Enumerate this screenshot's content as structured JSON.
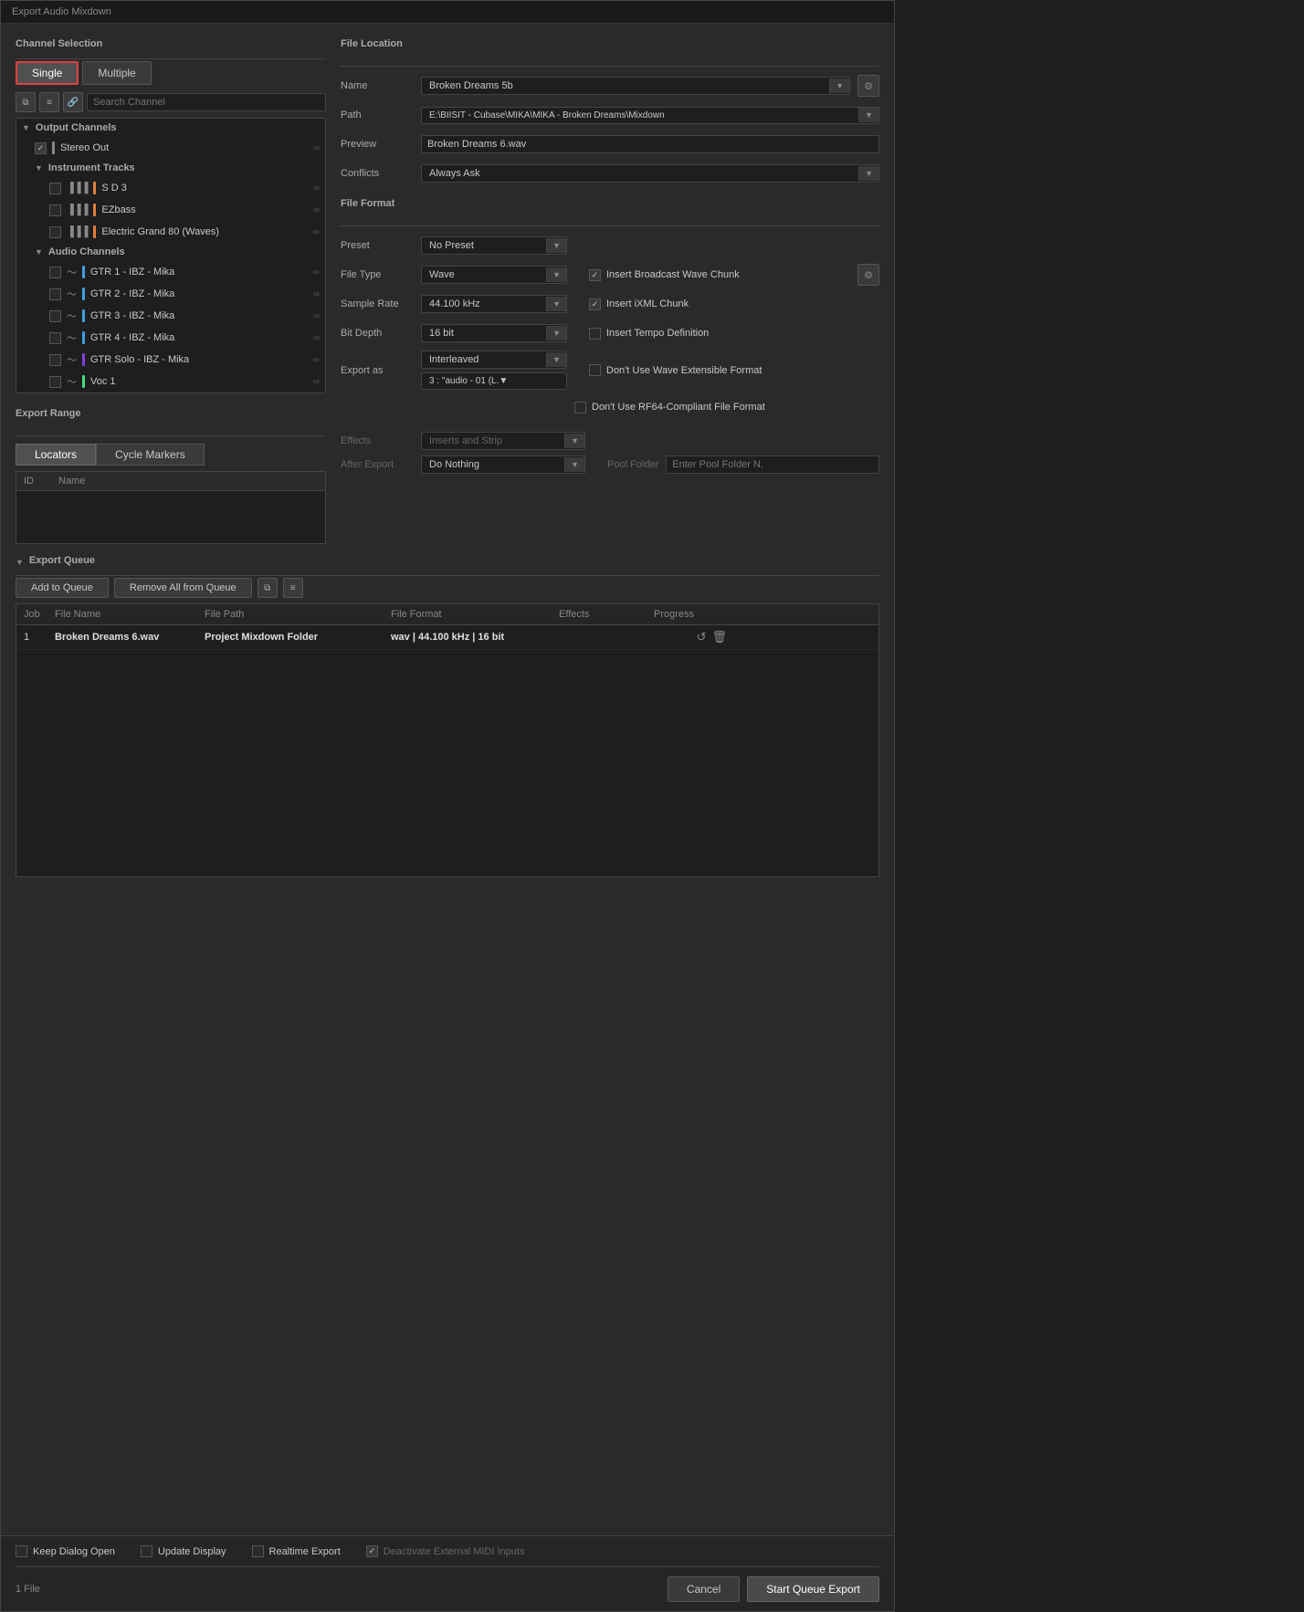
{
  "titlebar": {
    "title": "Export Audio Mixdown"
  },
  "channel_selection": {
    "label": "Channel Selection",
    "btn_single": "Single",
    "btn_multiple": "Multiple",
    "search_placeholder": "Search Channel",
    "output_channels_label": "Output Channels",
    "instrument_tracks_label": "Instrument Tracks",
    "audio_channels_label": "Audio Channels",
    "channels": [
      {
        "id": "stereo_out",
        "name": "Stereo Out",
        "type": "output",
        "color": "#888888",
        "checked": true,
        "indent": 1
      },
      {
        "id": "sd3",
        "name": "S D 3",
        "type": "instrument",
        "color": "#e08040",
        "checked": false,
        "indent": 2
      },
      {
        "id": "ezbass",
        "name": "EZbass",
        "type": "instrument",
        "color": "#e08040",
        "checked": false,
        "indent": 2
      },
      {
        "id": "elgrand",
        "name": "Electric Grand 80 (Waves)",
        "type": "instrument",
        "color": "#e08040",
        "checked": false,
        "indent": 2
      },
      {
        "id": "gtr1",
        "name": "GTR 1 - IBZ - Mika",
        "type": "audio",
        "color": "#40a0e0",
        "checked": false,
        "indent": 2
      },
      {
        "id": "gtr2",
        "name": "GTR 2 - IBZ - Mika",
        "type": "audio",
        "color": "#40a0e0",
        "checked": false,
        "indent": 2
      },
      {
        "id": "gtr3",
        "name": "GTR 3 - IBZ - Mika",
        "type": "audio",
        "color": "#40a0e0",
        "checked": false,
        "indent": 2
      },
      {
        "id": "gtr4",
        "name": "GTR 4 - IBZ - Mika",
        "type": "audio",
        "color": "#40a0e0",
        "checked": false,
        "indent": 2
      },
      {
        "id": "gtrsolo",
        "name": "GTR Solo - IBZ - Mika",
        "type": "audio",
        "color": "#8040e0",
        "checked": false,
        "indent": 2
      },
      {
        "id": "voc1",
        "name": "Voc 1",
        "type": "audio",
        "color": "#40e080",
        "checked": false,
        "indent": 2
      }
    ]
  },
  "file_location": {
    "label": "File Location",
    "name_label": "Name",
    "name_value": "Broken Dreams 5b",
    "path_label": "Path",
    "path_value": "E:\\BIISIT - Cubase\\MIKA\\MIKA - Broken Dreams\\Mixdown",
    "preview_label": "Preview",
    "preview_value": "Broken Dreams 6.wav",
    "conflicts_label": "Conflicts",
    "conflicts_value": "Always Ask"
  },
  "file_format": {
    "label": "File Format",
    "preset_label": "Preset",
    "preset_value": "No Preset",
    "file_type_label": "File Type",
    "file_type_value": "Wave",
    "sample_rate_label": "Sample Rate",
    "sample_rate_value": "44.100 kHz",
    "bit_depth_label": "Bit Depth",
    "bit_depth_value": "16 bit",
    "export_as_label": "Export as",
    "export_as_value": "Interleaved",
    "export_as_sub": "3 : \"audio - 01 (L.▼",
    "insert_bwf_label": "Insert Broadcast Wave Chunk",
    "insert_bwf_checked": true,
    "insert_ixml_label": "Insert iXML Chunk",
    "insert_ixml_checked": true,
    "insert_tempo_label": "Insert Tempo Definition",
    "insert_tempo_checked": false,
    "no_wave_ext_label": "Don't Use Wave Extensible Format",
    "no_wave_ext_checked": false,
    "no_rf64_label": "Don't Use RF64-Compliant File Format",
    "no_rf64_checked": false,
    "effects_label": "Effects",
    "effects_value": "Inserts and Strip",
    "after_export_label": "After Export",
    "after_export_value": "Do Nothing",
    "pool_folder_label": "Pool Folder",
    "pool_folder_placeholder": "Enter Pool Folder N."
  },
  "export_range": {
    "label": "Export Range",
    "btn_locators": "Locators",
    "btn_cycle_markers": "Cycle Markers",
    "col_id": "ID",
    "col_name": "Name"
  },
  "export_queue": {
    "label": "Export Queue",
    "btn_add": "Add to Queue",
    "btn_remove_all": "Remove All from Queue",
    "col_job": "Job",
    "col_file_name": "File Name",
    "col_file_path": "File Path",
    "col_file_format": "File Format",
    "col_effects": "Effects",
    "col_progress": "Progress",
    "rows": [
      {
        "job": "1",
        "file_name": "Broken Dreams 6.wav",
        "file_path": "Project Mixdown Folder",
        "file_format": "wav | 44.100 kHz | 16 bit",
        "effects": "",
        "progress": ""
      }
    ]
  },
  "bottom_bar": {
    "keep_dialog_label": "Keep Dialog Open",
    "update_display_label": "Update Display",
    "realtime_export_label": "Realtime Export",
    "deactivate_midi_label": "Deactivate External MIDI Inputs",
    "file_count": "1 File",
    "cancel_btn": "Cancel",
    "start_btn": "Start Queue Export"
  }
}
